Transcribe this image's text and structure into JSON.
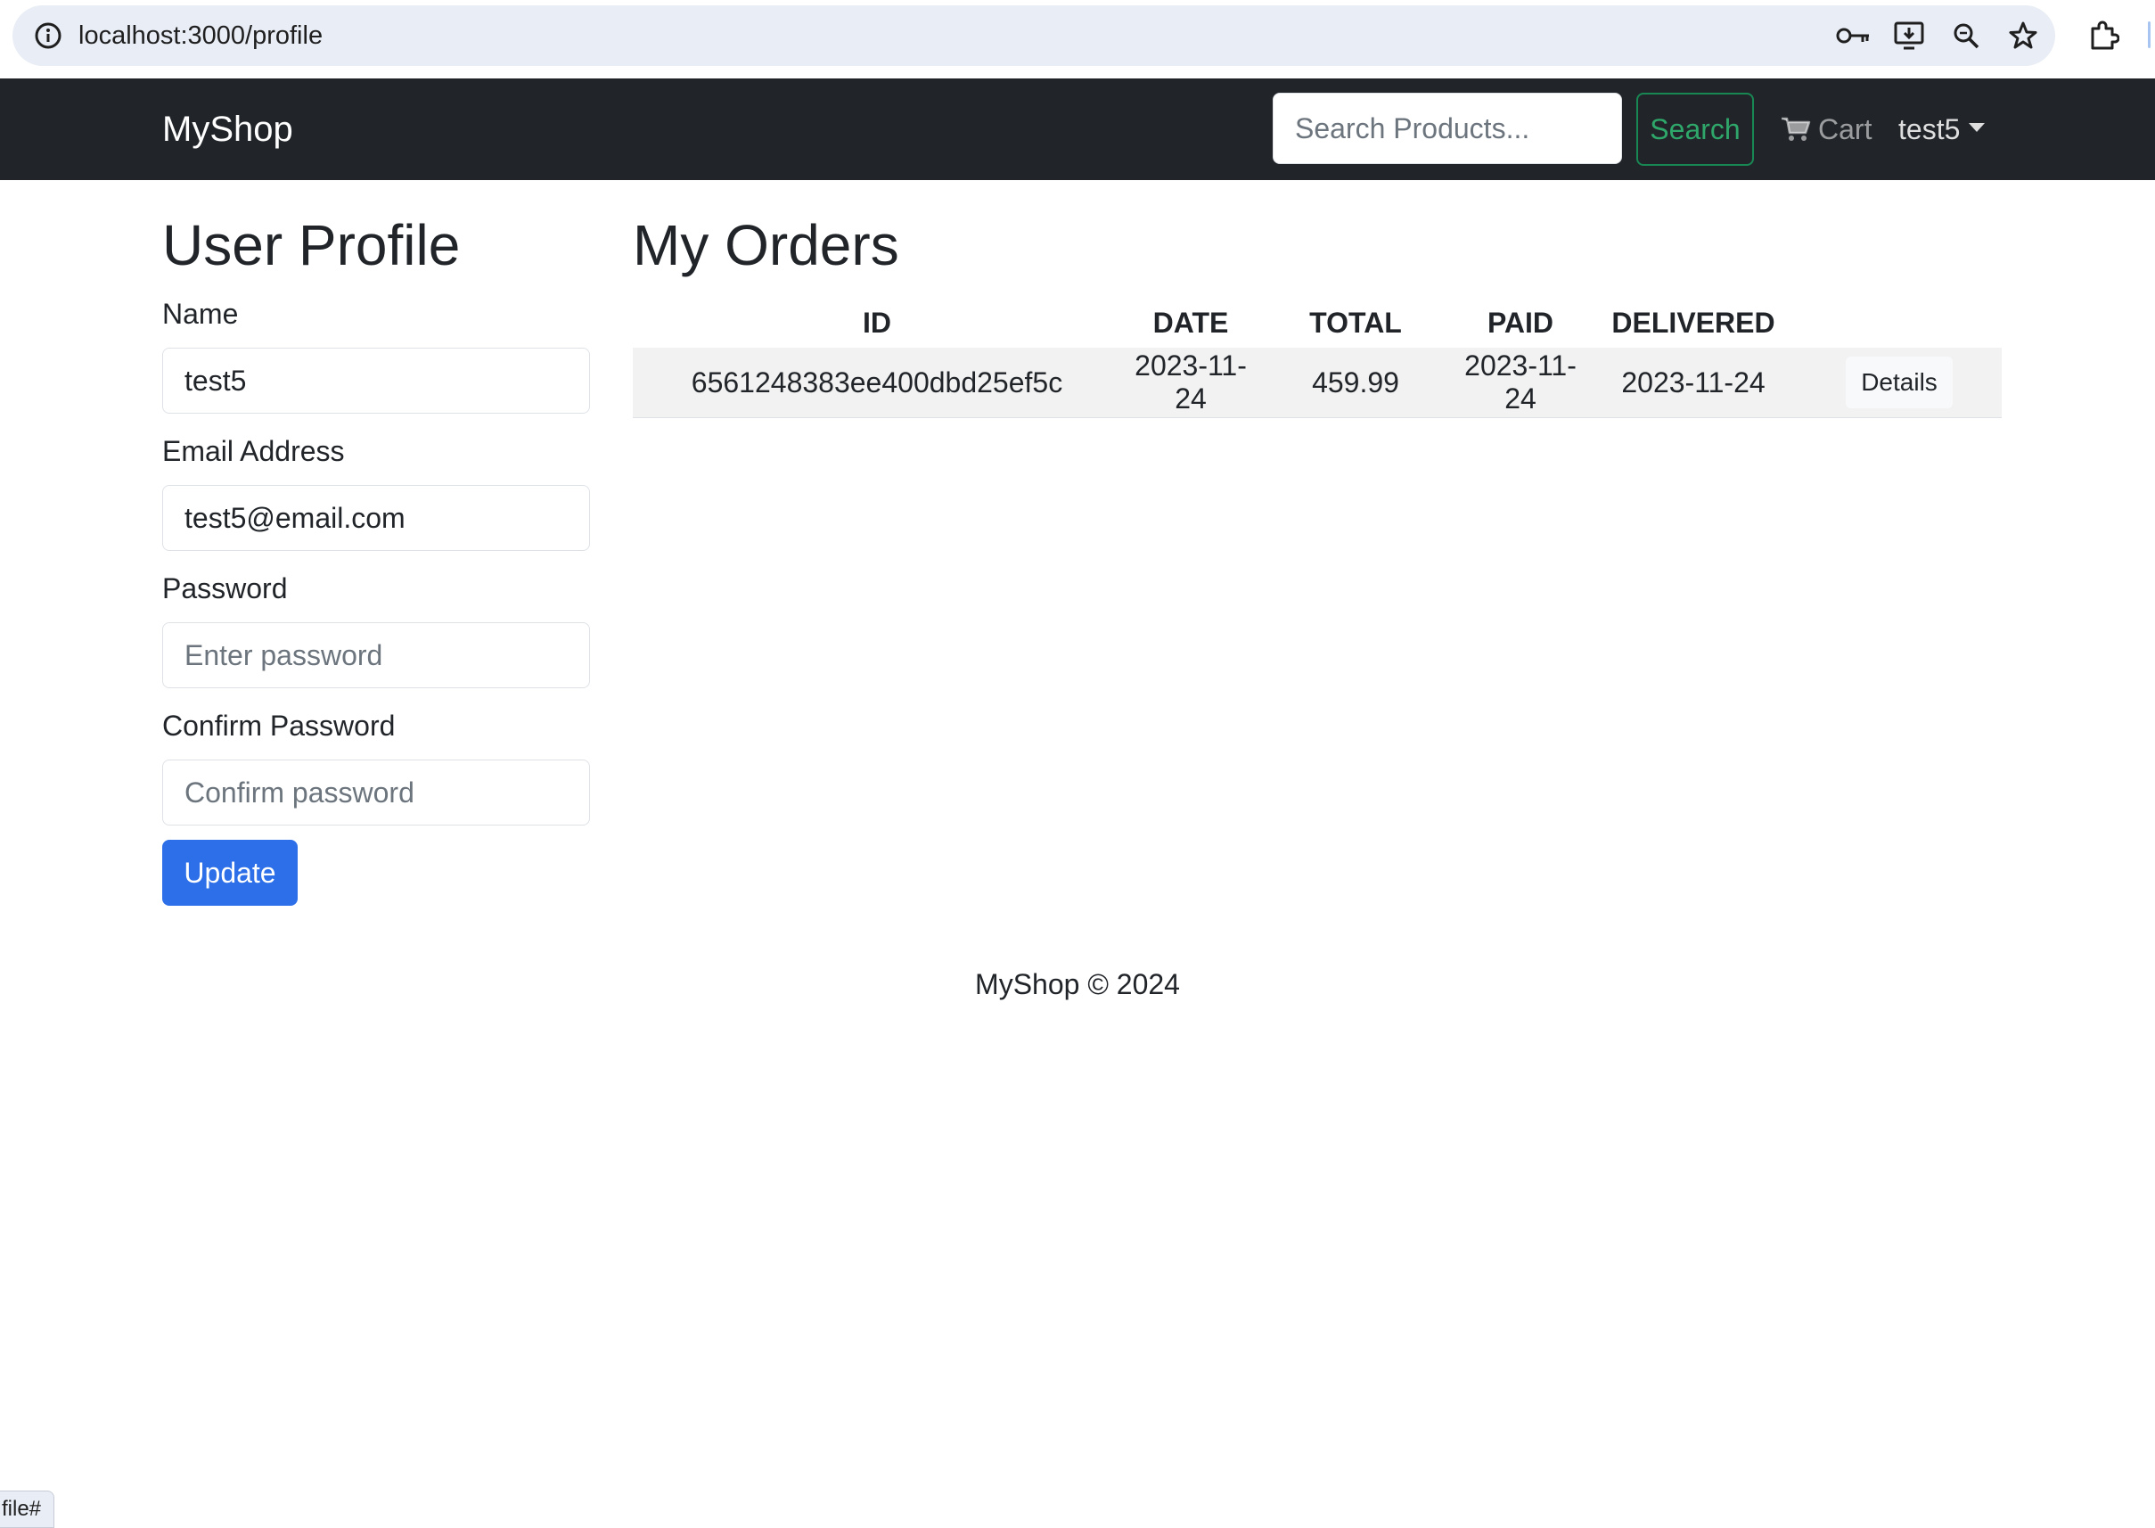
{
  "browser": {
    "url": "localhost:3000/profile",
    "status_text": "file#",
    "icons": [
      "info-icon",
      "key-icon",
      "install-app-icon",
      "zoom-icon",
      "bookmark-star-icon",
      "extensions-icon"
    ]
  },
  "navbar": {
    "brand": "MyShop",
    "search_placeholder": "Search Products...",
    "search_button": "Search",
    "cart_label": "Cart",
    "user_name": "test5"
  },
  "profile": {
    "title": "User Profile",
    "name_label": "Name",
    "name_value": "test5",
    "email_label": "Email Address",
    "email_value": "test5@email.com",
    "password_label": "Password",
    "password_placeholder": "Enter password",
    "confirm_label": "Confirm Password",
    "confirm_placeholder": "Confirm password",
    "update_button": "Update"
  },
  "orders": {
    "title": "My Orders",
    "columns": [
      "ID",
      "DATE",
      "TOTAL",
      "PAID",
      "DELIVERED"
    ],
    "rows": [
      {
        "id": "6561248383ee400dbd25ef5c",
        "date": "2023-11-24",
        "total": "459.99",
        "paid": "2023-11-24",
        "delivered": "2023-11-24",
        "details_label": "Details"
      }
    ]
  },
  "footer": {
    "text": "MyShop © 2024"
  },
  "colors": {
    "navbar_bg": "#212529",
    "primary_button": "#2c6fe8",
    "success_outline": "#198754",
    "table_stripe": "#f2f2f2"
  }
}
